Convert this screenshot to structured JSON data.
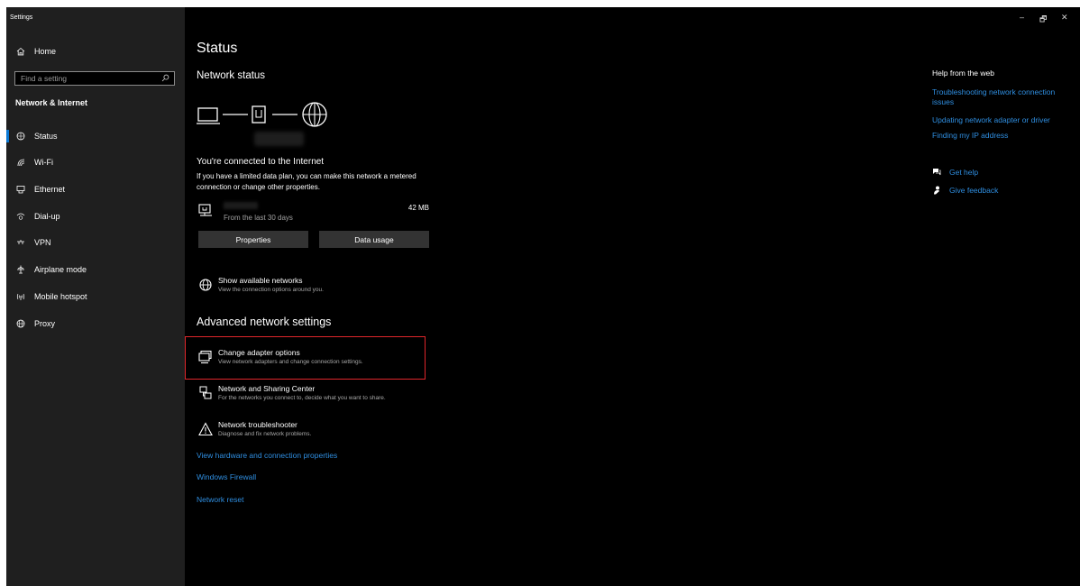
{
  "app": {
    "title": "Settings"
  },
  "sidebar": {
    "home": "Home",
    "search_placeholder": "Find a setting",
    "section": "Network & Internet",
    "items": [
      {
        "label": "Status",
        "icon": "status-icon"
      },
      {
        "label": "Wi-Fi",
        "icon": "wifi-icon"
      },
      {
        "label": "Ethernet",
        "icon": "ethernet-icon"
      },
      {
        "label": "Dial-up",
        "icon": "dialup-icon"
      },
      {
        "label": "VPN",
        "icon": "vpn-icon"
      },
      {
        "label": "Airplane mode",
        "icon": "airplane-icon"
      },
      {
        "label": "Mobile hotspot",
        "icon": "hotspot-icon"
      },
      {
        "label": "Proxy",
        "icon": "globe-icon"
      }
    ]
  },
  "main": {
    "title": "Status",
    "network_status": "Network status",
    "connected_title": "You're connected to the Internet",
    "connected_desc": "If you have a limited data plan, you can make this network a metered connection or change other properties.",
    "usage_sub": "From the last 30 days",
    "usage_amount": "42 MB",
    "btn_properties": "Properties",
    "btn_data_usage": "Data usage",
    "show_networks_title": "Show available networks",
    "show_networks_desc": "View the connection options around you.",
    "advanced_title": "Advanced network settings",
    "adapter_title": "Change adapter options",
    "adapter_desc": "View network adapters and change connection settings.",
    "sharing_title": "Network and Sharing Center",
    "sharing_desc": "For the networks you connect to, decide what you want to share.",
    "troubleshooter_title": "Network troubleshooter",
    "troubleshooter_desc": "Diagnose and fix network problems.",
    "links": [
      "View hardware and connection properties",
      "Windows Firewall",
      "Network reset"
    ]
  },
  "right": {
    "title": "Help from the web",
    "links": [
      "Troubleshooting network connection issues",
      "Updating network adapter or driver",
      "Finding my IP address"
    ],
    "get_help": "Get help",
    "give_feedback": "Give feedback"
  },
  "window_controls": {
    "minimize": "–",
    "restore": "🗗",
    "close": "✕"
  },
  "colors": {
    "accent": "#0a78d4",
    "link": "#2f8ee0",
    "highlight": "#e0262b"
  }
}
